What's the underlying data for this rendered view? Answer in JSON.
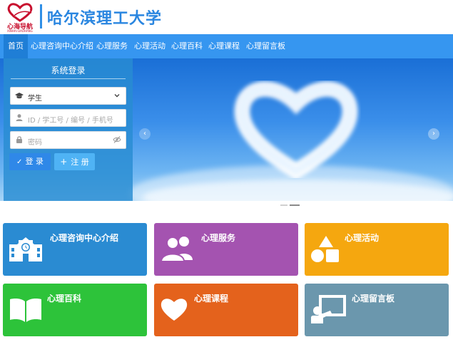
{
  "header": {
    "logo_text": "心海导航",
    "logo_sub": "XINHAI DAOHANG",
    "title": "哈尔滨理工大学"
  },
  "nav": {
    "items": [
      {
        "label": "首页",
        "active": true
      },
      {
        "label": "心理咨询中心介绍"
      },
      {
        "label": "心理服务"
      },
      {
        "label": "心理活动"
      },
      {
        "label": "心理百科"
      },
      {
        "label": "心理课程"
      },
      {
        "label": "心理留言板"
      }
    ]
  },
  "login": {
    "title": "系统登录",
    "role_select_value": "学生",
    "id_placeholder": "ID / 学工号 / 编号 / 手机号",
    "password_placeholder": "密码",
    "login_button": "登 录",
    "register_button": "注 册"
  },
  "cards": [
    {
      "label": "心理咨询中心介绍",
      "color": "#2a8bd2",
      "icon": "school-building-icon"
    },
    {
      "label": "心理服务",
      "color": "#a453b0",
      "icon": "users-icon"
    },
    {
      "label": "心理活动",
      "color": "#f5a70f",
      "icon": "shapes-icon"
    },
    {
      "label": "心理百科",
      "color": "#2dc33a",
      "icon": "open-book-icon"
    },
    {
      "label": "心理课程",
      "color": "#e4621c",
      "icon": "heart-icon"
    },
    {
      "label": "心理留言板",
      "color": "#6b97ad",
      "icon": "presentation-board-icon"
    }
  ],
  "colors": {
    "nav_bg": "#3696f0",
    "title_blue": "#2a86e0"
  }
}
